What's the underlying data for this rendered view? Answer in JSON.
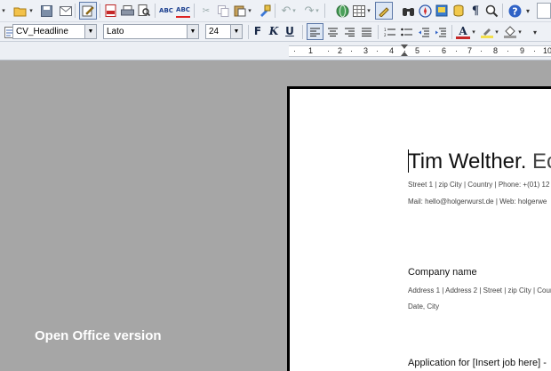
{
  "toolbar_standard": {
    "icons": [
      "new-dropdown-arrow-icon",
      "open-folder-icon",
      "save-icon",
      "email-icon",
      "edit-mode-icon",
      "export-pdf-icon",
      "print-icon",
      "print-preview-icon",
      "spellcheck-icon",
      "autospellcheck-icon",
      "cut-icon",
      "copy-icon",
      "paste-icon",
      "clone-formatting-icon",
      "undo-icon",
      "redo-icon",
      "hyperlink-icon",
      "table-icon",
      "draw-functions-icon",
      "find-replace-icon",
      "navigator-icon",
      "gallery-icon",
      "data-sources-icon",
      "nonprinting-characters-icon",
      "zoom-icon",
      "help-icon"
    ]
  },
  "toolbar_format": {
    "paragraph_style": "CV_Headline",
    "font_name": "Lato",
    "font_size": "24",
    "bold_label": "F",
    "italic_label": "K",
    "underline_label": "U"
  },
  "ruler": {
    "numbers": [
      "1",
      "2",
      "3",
      "4",
      "5",
      "6",
      "7",
      "8",
      "9",
      "10"
    ]
  },
  "document": {
    "headline_name": "Tim Welther.",
    "headline_extra": "Ec",
    "address_line": "Street 1 | zip City | Country | Phone: +(01) 12",
    "contact_line": "Mail: hello@holgerwurst.de | Web: holgerwe",
    "company_name": "Company name",
    "company_address": "Address 1 | Address 2 | Street | zip City | Cour",
    "date_line": "Date, City",
    "application_line": "Application for [Insert job here] -"
  },
  "caption": "Open Office version"
}
